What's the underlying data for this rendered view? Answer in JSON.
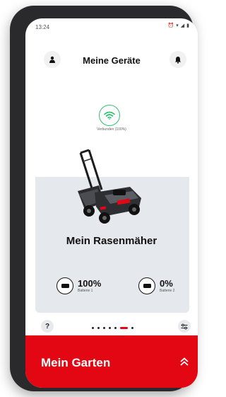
{
  "status_bar": {
    "time": "13:24",
    "icons": [
      "alarm-icon",
      "wifi-icon",
      "signal-icon",
      "battery-icon"
    ]
  },
  "header": {
    "title": "Meine Geräte",
    "left_icon": "user-icon",
    "right_icon": "bell-icon"
  },
  "device": {
    "connection_status": "Verbunden (100%)",
    "name": "Mein Rasenmäher",
    "batteries": [
      {
        "percent": "100%",
        "label": "Batterie 1"
      },
      {
        "percent": "0%",
        "label": "Batterie 2"
      }
    ]
  },
  "pager": {
    "count": 6,
    "active_index": 5,
    "left_icon_text": "?"
  },
  "footer": {
    "title": "Mein Garten"
  },
  "colors": {
    "accent": "#e30613",
    "connected": "#2fbf71",
    "card_bg": "#e5e8ec"
  }
}
